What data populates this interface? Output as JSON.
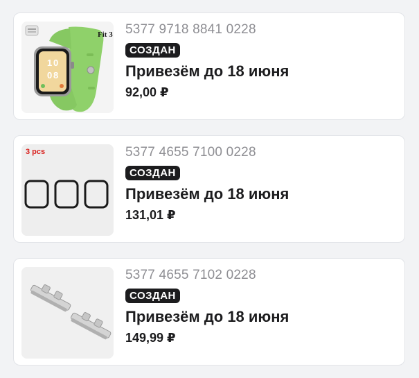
{
  "orders": [
    {
      "order_number": "5377 9718 8841 0228",
      "status": "СОЗДАН",
      "delivery": "Привезём до 18 июня",
      "price": "92,00 ₽",
      "thumb_label": "Fit 3",
      "thumb_icon": "smartwatch"
    },
    {
      "order_number": "5377 4655 7100 0228",
      "status": "СОЗДАН",
      "delivery": "Привезём до 18 июня",
      "price": "131,01 ₽",
      "thumb_label": "3 pcs",
      "thumb_icon": "screen-protectors"
    },
    {
      "order_number": "5377 4655 7102 0228",
      "status": "СОЗДАН",
      "delivery": "Привезём до 18 июня",
      "price": "149,99 ₽",
      "thumb_icon": "metal-strap-connectors"
    }
  ],
  "colors": {
    "watch_strap": "#8fd16a",
    "badge_bg": "#1c1c1e",
    "muted_text": "#8e8e93",
    "thumb_label_red": "#d9211e"
  }
}
